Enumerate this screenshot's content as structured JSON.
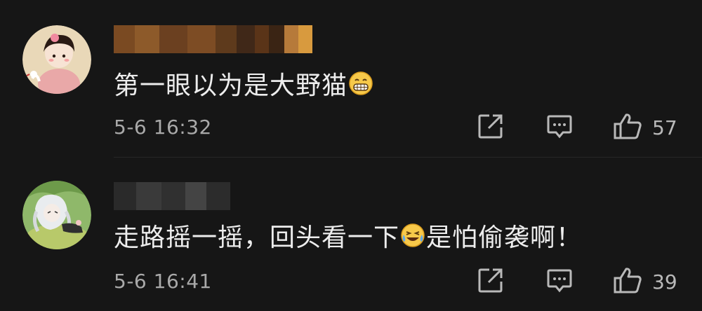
{
  "comments": [
    {
      "text_before_emoji": "第一眼以为是大野猫",
      "emoji": "grinning-face-emoji",
      "text_after_emoji": "",
      "time": "5-6 16:32",
      "likes": "57"
    },
    {
      "text_before_emoji": "走路摇一摇，回头看一下",
      "emoji": "laughing-crying-emoji",
      "text_after_emoji": "是怕偷袭啊！",
      "time": "5-6 16:41",
      "likes": "39"
    }
  ],
  "icons": {
    "share": "share-icon",
    "reply": "comment-icon",
    "like": "thumbs-up-icon"
  },
  "colors": {
    "background": "#161616",
    "text": "#ededed",
    "meta": "#a9a9a9"
  }
}
